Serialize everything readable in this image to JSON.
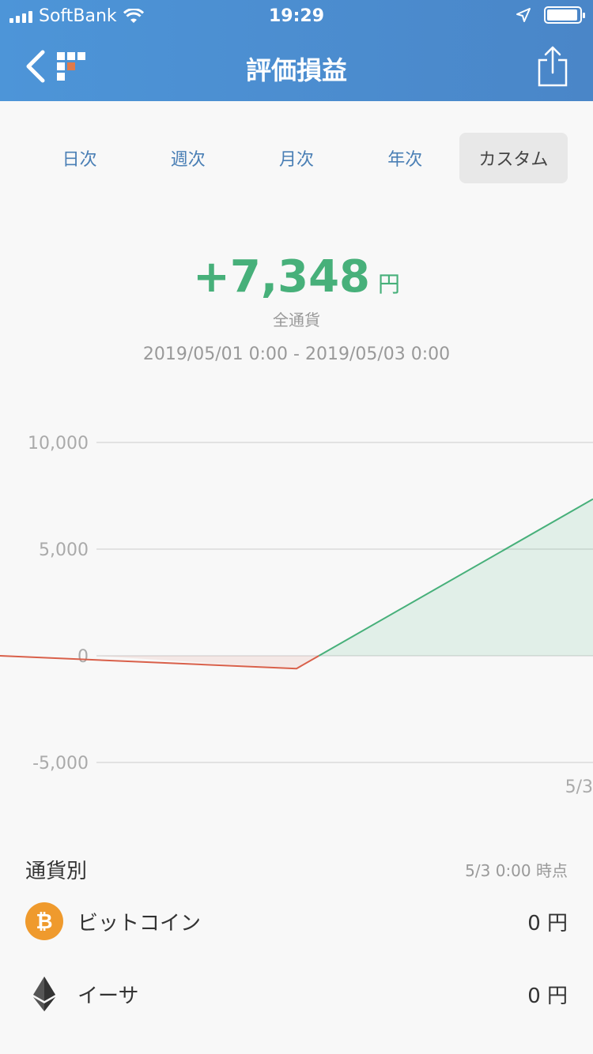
{
  "status": {
    "carrier": "SoftBank",
    "time": "19:29"
  },
  "nav": {
    "title": "評価損益",
    "back_icon": "chevron-left-icon",
    "share_icon": "share-icon"
  },
  "tabs": [
    {
      "label": "日次",
      "active": false
    },
    {
      "label": "週次",
      "active": false
    },
    {
      "label": "月次",
      "active": false
    },
    {
      "label": "年次",
      "active": false
    },
    {
      "label": "カスタム",
      "active": true
    }
  ],
  "summary": {
    "amount": "+7,348",
    "unit": "円",
    "scope": "全通貨",
    "range": "2019/05/01 0:00 - 2019/05/03 0:00"
  },
  "colors": {
    "profit": "#47b07a",
    "loss": "#d9604a",
    "header": "#4a8fd3"
  },
  "chart_data": {
    "type": "area",
    "y_ticks": [
      "10,000",
      "5,000",
      "0",
      "-5,000"
    ],
    "ylim": [
      -5000,
      10000
    ],
    "x_labels": [
      "5/3"
    ],
    "points": [
      {
        "x": "5/1 0:00",
        "y": 0
      },
      {
        "x": "5/2 0:00",
        "y": -600
      },
      {
        "x": "5/3 0:00",
        "y": 7348
      }
    ]
  },
  "by_currency": {
    "title": "通貨別",
    "as_of": "5/3 0:00 時点",
    "items": [
      {
        "name": "ビットコイン",
        "value": "0 円",
        "icon": "bitcoin-icon"
      },
      {
        "name": "イーサ",
        "value": "0 円",
        "icon": "ethereum-icon"
      }
    ]
  }
}
